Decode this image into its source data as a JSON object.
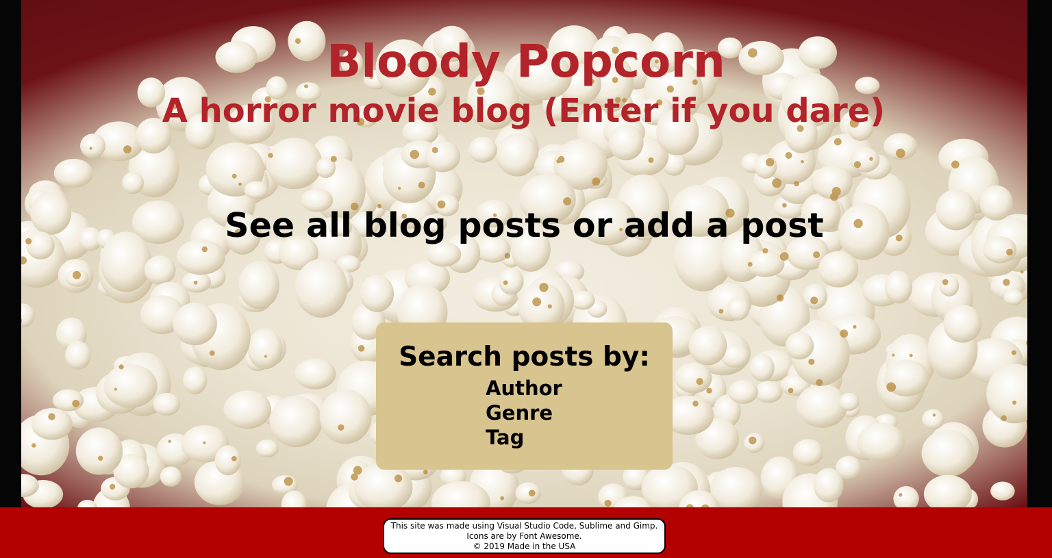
{
  "header": {
    "title": "Bloody Popcorn",
    "subtitle": "A horror movie blog (Enter if you dare)"
  },
  "cta": {
    "see_all": "See all blog posts",
    "or": " or ",
    "add_post": "add a post"
  },
  "search": {
    "heading": "Search posts by:",
    "options": [
      "Author",
      "Genre",
      "Tag"
    ]
  },
  "footer": {
    "line1": "This site was made using Visual Studio Code, Sublime and Gimp.",
    "line2": "Icons are by Font Awesome.",
    "line3": "© 2019 Made in the USA"
  },
  "colors": {
    "title_red": "#b3232a",
    "footer_red": "#b30000",
    "search_box_tan": "#d8c48f"
  },
  "background": {
    "image": "popcorn-bowl-photo"
  }
}
